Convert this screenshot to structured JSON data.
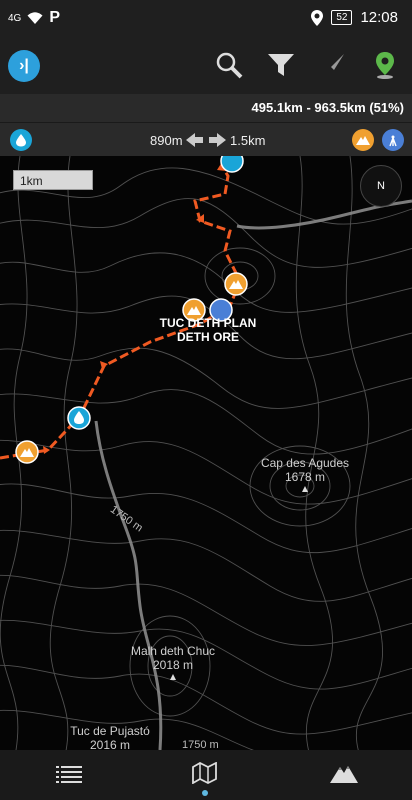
{
  "status": {
    "network": "4G",
    "carrier_logo": "P",
    "battery": "52",
    "time": "12:08"
  },
  "toolbar": {
    "icons": [
      "app-logo-icon",
      "search-icon",
      "filter-icon",
      "navigate-icon",
      "location-pin-icon"
    ]
  },
  "stats": {
    "distance_text": "495.1km - 963.5km (51%)"
  },
  "range": {
    "from": "890m",
    "to": "1.5km"
  },
  "map": {
    "scale_label": "1km",
    "compass_label": "N",
    "labels": {
      "poi_name_line1": "TUC DETH PLAN",
      "poi_name_line2": "DETH ORE",
      "peak1_name": "Cap des Agudes",
      "peak1_elev": "1678 m",
      "peak2_name": "Malh deth Chuc",
      "peak2_elev": "2018 m",
      "peak3_name": "Tuc de Pujastó",
      "peak3_elev": "2016 m",
      "contour1": "1750 m",
      "contour2": "1750 m"
    },
    "colors": {
      "route": "#f05a22",
      "water": "#1aa5d8",
      "peak_marker": "#f0a030",
      "signal_marker": "#4a7fd6"
    }
  },
  "bottom_nav": {
    "icons": [
      "list-icon",
      "map-icon",
      "mountain-icon"
    ]
  }
}
